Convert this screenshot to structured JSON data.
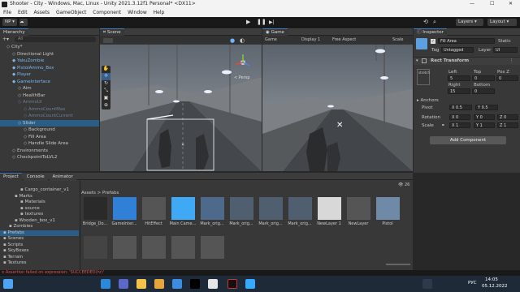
{
  "window": {
    "title": "Shooter - City - Windows, Mac, Linux - Unity 2021.3.12f1 Personal* <DX11>",
    "controls": [
      "—",
      "☐",
      "✕"
    ]
  },
  "menu": [
    "File",
    "Edit",
    "Assets",
    "GameObject",
    "Component",
    "Window",
    "Help"
  ],
  "toolbar": {
    "account": "NP",
    "layers": "Layers",
    "layout": "Layout"
  },
  "hierarchy": {
    "tab": "Hierarchy",
    "search_placeholder": "All",
    "items": [
      {
        "label": "City*",
        "indent": 0,
        "style": "normal"
      },
      {
        "label": "Directional Light",
        "indent": 1,
        "style": "normal"
      },
      {
        "label": "YakuZombie",
        "indent": 1,
        "style": "blue"
      },
      {
        "label": "PistolAmmo_Box",
        "indent": 1,
        "style": "blue"
      },
      {
        "label": "Player",
        "indent": 1,
        "style": "blue"
      },
      {
        "label": "GameInterface",
        "indent": 1,
        "style": "blue"
      },
      {
        "label": "Aim",
        "indent": 2,
        "style": "normal"
      },
      {
        "label": "HealthBar",
        "indent": 2,
        "style": "normal"
      },
      {
        "label": "AmmoUI",
        "indent": 2,
        "style": "dim"
      },
      {
        "label": "AmmoCountMax",
        "indent": 3,
        "style": "dim"
      },
      {
        "label": "AmmoCountCurrent",
        "indent": 3,
        "style": "dim"
      },
      {
        "label": "Slider",
        "indent": 2,
        "style": "normal"
      },
      {
        "label": "Background",
        "indent": 3,
        "style": "normal"
      },
      {
        "label": "Fill Area",
        "indent": 3,
        "style": "normal"
      },
      {
        "label": "Handle Slide Area",
        "indent": 3,
        "style": "normal"
      },
      {
        "label": "Environments",
        "indent": 1,
        "style": "normal"
      },
      {
        "label": "CheckpointToLVL2",
        "indent": 1,
        "style": "normal"
      }
    ]
  },
  "scene": {
    "tab": "Scene",
    "persp": "< Persp"
  },
  "game": {
    "tab": "Game",
    "display_mode": "Game",
    "display": "Display 1",
    "aspect": "Free Aspect",
    "scale": "Scale"
  },
  "inspector": {
    "tab": "Inspector",
    "object_name": "Fill Area",
    "static_label": "Static",
    "tag_label": "Tag",
    "tag_value": "Untagged",
    "layer_label": "Layer",
    "layer_value": "UI",
    "component": "Rect Transform",
    "stretch": "stretch",
    "left_label": "Left",
    "left_value": "5",
    "top_label": "Top",
    "top_value": "0",
    "posz_label": "Pos Z",
    "posz_value": "0",
    "right_label": "Right",
    "right_value": "15",
    "bottom_label": "Bottom",
    "bottom_value": "0",
    "anchors": "Anchors",
    "pivot_label": "Pivot",
    "pivot_x": "X 0.5",
    "pivot_y": "Y 0.5",
    "rotation_label": "Rotation",
    "rot_x": "X 0",
    "rot_y": "Y 0",
    "rot_z": "Z 0",
    "scale_label": "Scale",
    "scale_x": "X 1",
    "scale_y": "Y 1",
    "scale_z": "Z 1",
    "add_component": "Add Component"
  },
  "project": {
    "tabs": [
      "Project",
      "Console",
      "Animator"
    ],
    "breadcrumb": "Assets > Prefabs",
    "count": "26",
    "tree": [
      {
        "label": "Cargo_container_v1",
        "indent": 3
      },
      {
        "label": "Marks",
        "indent": 2
      },
      {
        "label": "Materials",
        "indent": 3
      },
      {
        "label": "source",
        "indent": 3
      },
      {
        "label": "textures",
        "indent": 3
      },
      {
        "label": "Wooden_box_v1",
        "indent": 2
      },
      {
        "label": "Zombies",
        "indent": 1
      },
      {
        "label": "Prefabs",
        "indent": 0
      },
      {
        "label": "Scenes",
        "indent": 0
      },
      {
        "label": "Scripts",
        "indent": 0
      },
      {
        "label": "SkyBoxes",
        "indent": 0
      },
      {
        "label": "Terrain",
        "indent": 0
      },
      {
        "label": "Textures",
        "indent": 0
      }
    ],
    "assets": [
      "Bridge_Do...",
      "GameInter...",
      "HitEffect",
      "Main Came...",
      "Mark_orig...",
      "Mark_orig...",
      "Mark_orig...",
      "Mark_orig...",
      "NewLayer 1",
      "NewLayer",
      "Pistol",
      "",
      "",
      "",
      "",
      ""
    ]
  },
  "status": {
    "message": "Assertion failed on expression: 'SUCCEEDED(hr)'"
  },
  "taskbar": {
    "lang": "РУС",
    "time": "14:05",
    "date": "05.12.2022"
  }
}
